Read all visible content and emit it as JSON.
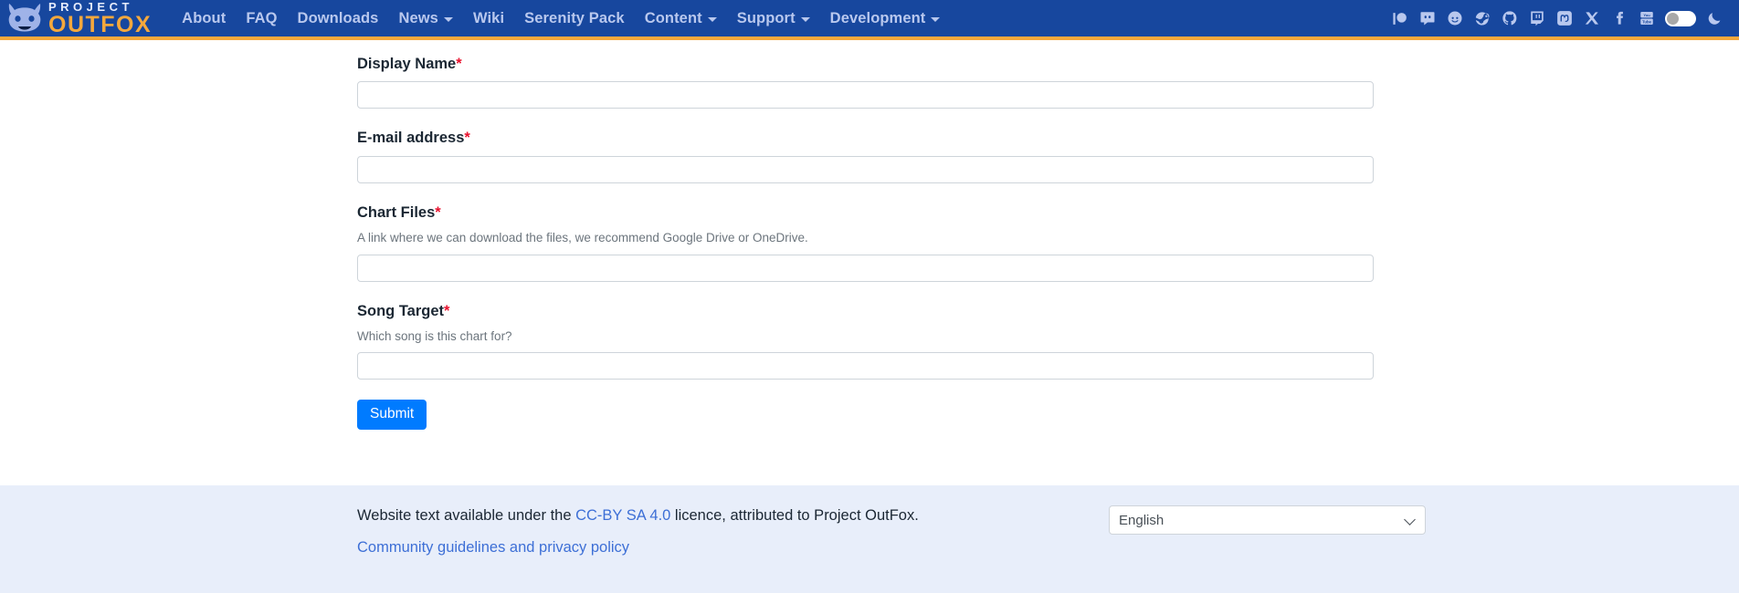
{
  "navbar": {
    "brand": {
      "top_text": "PROJECT",
      "bottom_text": "OUTFOX",
      "logo_icon": "outfox-mascot-icon"
    },
    "links": [
      {
        "label": "About",
        "dropdown": false
      },
      {
        "label": "FAQ",
        "dropdown": false
      },
      {
        "label": "Downloads",
        "dropdown": false
      },
      {
        "label": "News",
        "dropdown": true
      },
      {
        "label": "Wiki",
        "dropdown": false
      },
      {
        "label": "Serenity Pack",
        "dropdown": false
      },
      {
        "label": "Content",
        "dropdown": true
      },
      {
        "label": "Support",
        "dropdown": true
      },
      {
        "label": "Development",
        "dropdown": true
      }
    ],
    "social_icons": [
      "patreon-icon",
      "discord-icon",
      "reddit-icon",
      "steam-icon",
      "github-icon",
      "twitch-icon",
      "mastodon-icon",
      "x-twitter-icon",
      "facebook-icon",
      "youtube-icon"
    ],
    "theme_toggle": {
      "name": "theme-toggle",
      "state": "off"
    },
    "moon_icon": "moon-icon",
    "colors": {
      "background": "#17479e",
      "accent_bar": "#f5a83c",
      "link_text": "#b9c8ee"
    }
  },
  "form": {
    "fields": [
      {
        "label": "Display Name",
        "required_mark": "*",
        "help": "",
        "value": "",
        "placeholder": ""
      },
      {
        "label": "E-mail address",
        "required_mark": "*",
        "help": "",
        "value": "",
        "placeholder": ""
      },
      {
        "label": "Chart Files",
        "required_mark": "*",
        "help": "A link where we can download the files, we recommend Google Drive or OneDrive.",
        "value": "",
        "placeholder": ""
      },
      {
        "label": "Song Target",
        "required_mark": "*",
        "help": "Which song is this chart for?",
        "value": "",
        "placeholder": ""
      }
    ],
    "submit_label": "Submit",
    "submit_color": "#007bff"
  },
  "footer": {
    "licence_prefix": "Website text available under the ",
    "licence_link": "CC-BY SA 4.0",
    "licence_suffix": " licence, attributed to Project OutFox.",
    "guidelines_link": "Community guidelines and privacy policy",
    "language": {
      "selected": "English",
      "options": [
        "English"
      ]
    },
    "background": "#e8eefa",
    "link_color": "#3d6fd6"
  }
}
